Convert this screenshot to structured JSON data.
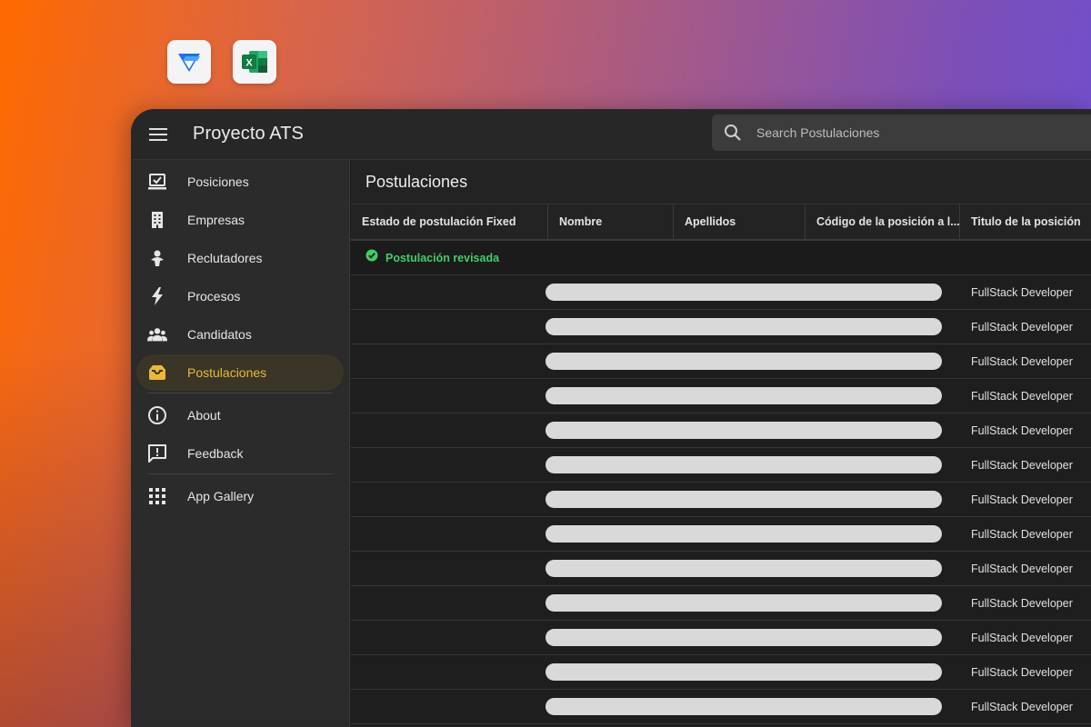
{
  "colors": {
    "accent": "#e8b93a",
    "success": "#3fcf68",
    "background": "#1f1f1f"
  },
  "dock": {
    "icons": [
      "appsheet-icon",
      "excel-icon"
    ],
    "excel_letter": "X"
  },
  "header": {
    "app_title": "Proyecto ATS",
    "search_placeholder": "Search Postulaciones"
  },
  "sidebar": {
    "items": [
      {
        "label": "Posiciones",
        "icon": "checklist-icon"
      },
      {
        "label": "Empresas",
        "icon": "building-icon"
      },
      {
        "label": "Reclutadores",
        "icon": "person-pin-icon"
      },
      {
        "label": "Procesos",
        "icon": "bolt-icon"
      },
      {
        "label": "Candidatos",
        "icon": "group-icon"
      },
      {
        "label": "Postulaciones",
        "icon": "inbox-icon",
        "active": true
      }
    ],
    "secondary": [
      {
        "label": "About",
        "icon": "info-icon"
      },
      {
        "label": "Feedback",
        "icon": "feedback-icon"
      }
    ],
    "tertiary": [
      {
        "label": "App Gallery",
        "icon": "apps-grid-icon"
      }
    ]
  },
  "main": {
    "page_title": "Postulaciones",
    "columns": [
      "Estado de postulación Fixed",
      "Nombre",
      "Apellidos",
      "Código de la posición a l...",
      "Titulo de la posición"
    ],
    "group": {
      "label": "Postulación revisada",
      "icon": "check-circle-icon"
    },
    "rows": [
      {
        "titulo": "FullStack Developer"
      },
      {
        "titulo": "FullStack Developer"
      },
      {
        "titulo": "FullStack Developer"
      },
      {
        "titulo": "FullStack Developer"
      },
      {
        "titulo": "FullStack Developer"
      },
      {
        "titulo": "FullStack Developer"
      },
      {
        "titulo": "FullStack Developer"
      },
      {
        "titulo": "FullStack Developer"
      },
      {
        "titulo": "FullStack Developer"
      },
      {
        "titulo": "FullStack Developer"
      },
      {
        "titulo": "FullStack Developer"
      },
      {
        "titulo": "FullStack Developer"
      },
      {
        "titulo": "FullStack Developer"
      }
    ]
  }
}
